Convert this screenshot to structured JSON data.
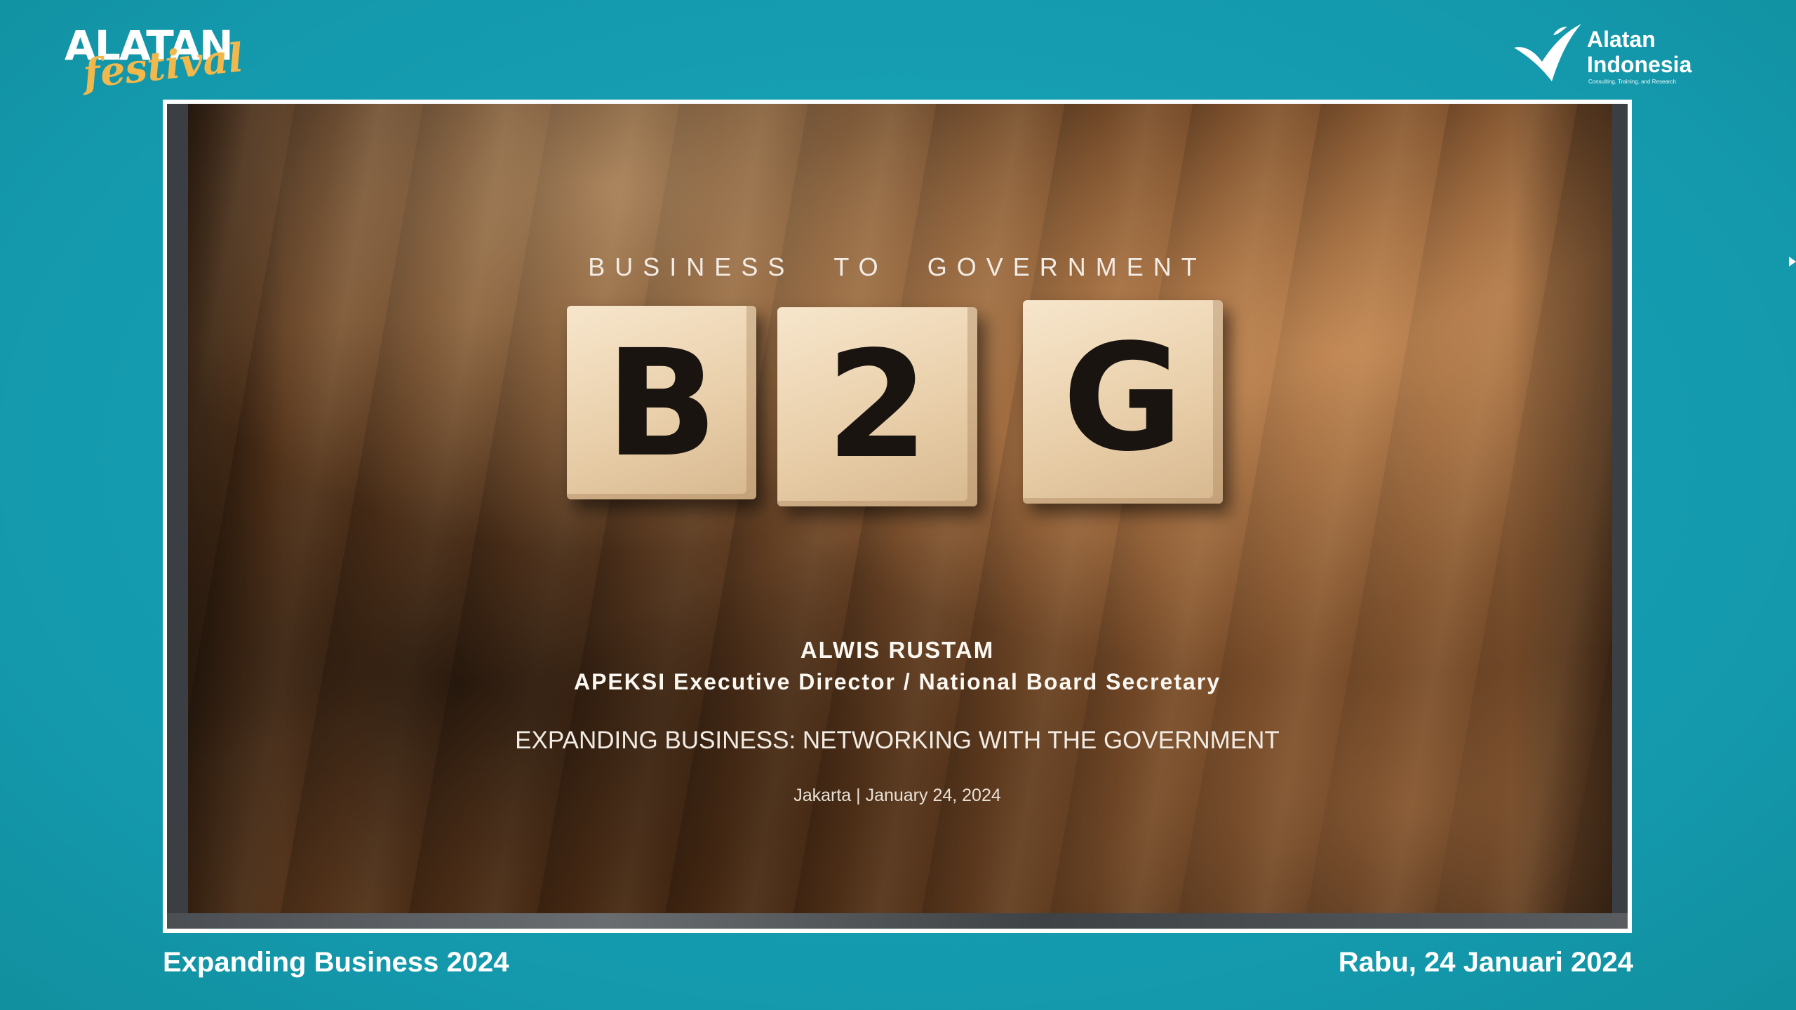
{
  "event_logo": {
    "word": "ALATAN",
    "script": "festival"
  },
  "brand_logo": {
    "line1": "Alatan",
    "line2": "Indonesia",
    "tagline": "Consulting, Training, and Research"
  },
  "slide": {
    "subtitle_words": [
      "BUSINESS",
      "TO",
      "GOVERNMENT"
    ],
    "blocks": [
      "B",
      "2",
      "G"
    ],
    "speaker_name": "ALWIS RUSTAM",
    "speaker_role": "APEKSI Executive Director / National Board Secretary",
    "talk_title": "EXPANDING BUSINESS: NETWORKING WITH THE GOVERNMENT",
    "talk_date": "Jakarta | January 24, 2024"
  },
  "footer": {
    "left": "Expanding Business 2024",
    "right": "Rabu, 24 Januari 2024"
  },
  "colors": {
    "background": "#159fb3",
    "festival_accent": "#f2b84b",
    "block_face": "#e9cfaa"
  }
}
